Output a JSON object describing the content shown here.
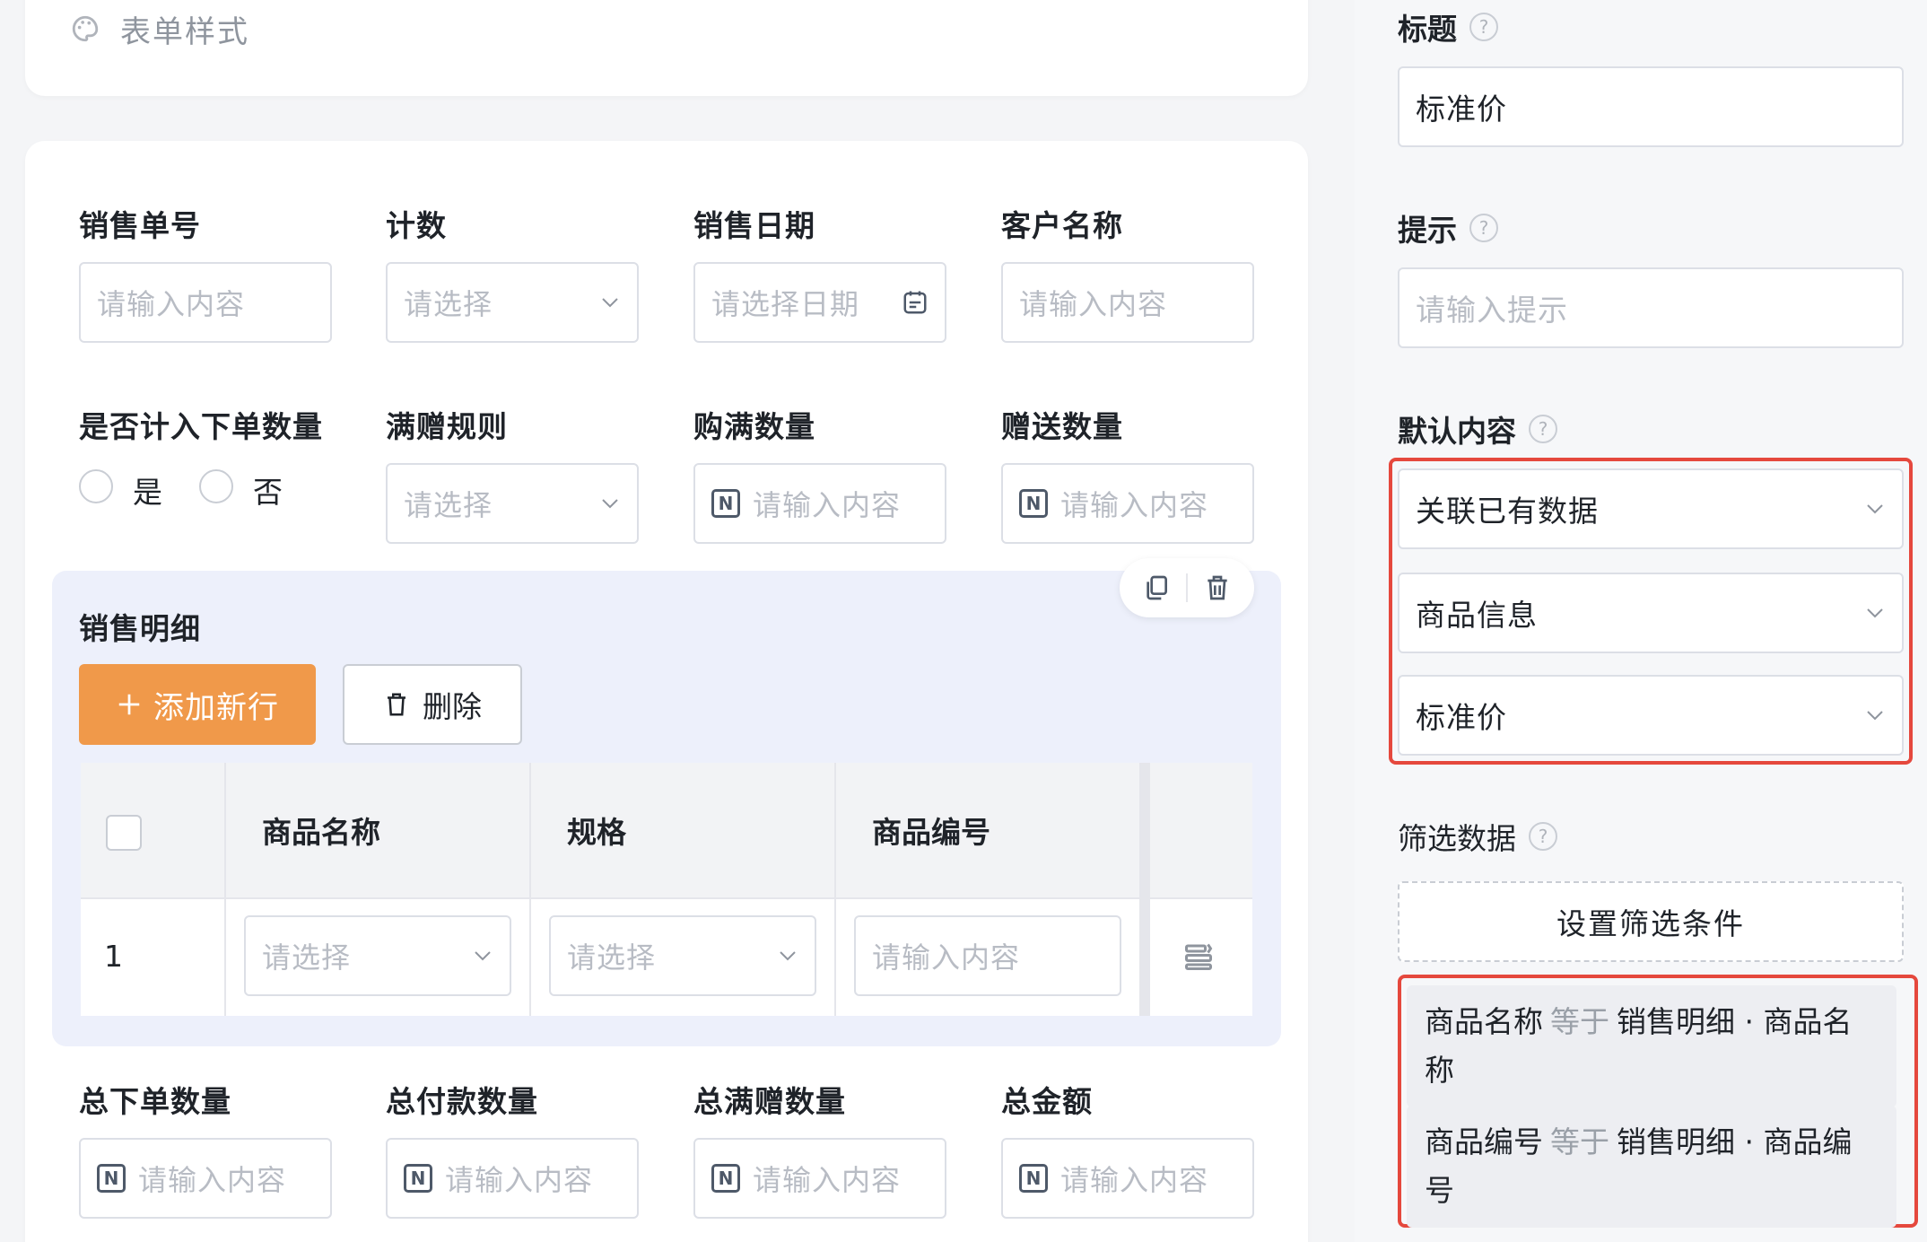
{
  "left": {
    "style_section": {
      "icon": "palette-icon",
      "label": "表单样式"
    },
    "row1": [
      {
        "label": "销售单号",
        "placeholder": "请输入内容",
        "kind": "text"
      },
      {
        "label": "计数",
        "placeholder": "请选择",
        "kind": "select"
      },
      {
        "label": "销售日期",
        "placeholder": "请选择日期",
        "kind": "date"
      },
      {
        "label": "客户名称",
        "placeholder": "请输入内容",
        "kind": "text"
      }
    ],
    "row2": {
      "radio_field": {
        "label": "是否计入下单数量",
        "options": [
          "是",
          "否"
        ]
      },
      "fields": [
        {
          "label": "满赠规则",
          "placeholder": "请选择",
          "kind": "select"
        },
        {
          "label": "购满数量",
          "placeholder": "请输入内容",
          "kind": "number"
        },
        {
          "label": "赠送数量",
          "placeholder": "请输入内容",
          "kind": "number"
        }
      ]
    },
    "subtable": {
      "title": "销售明细",
      "add_button": "添加新行",
      "delete_button": "删除",
      "columns": [
        "商品名称",
        "规格",
        "商品编号"
      ],
      "rows": [
        {
          "index": "1",
          "cells": [
            "请选择",
            "请选择",
            "请输入内容"
          ]
        }
      ]
    },
    "row3": [
      {
        "label": "总下单数量",
        "placeholder": "请输入内容"
      },
      {
        "label": "总付款数量",
        "placeholder": "请输入内容"
      },
      {
        "label": "总满赠数量",
        "placeholder": "请输入内容"
      },
      {
        "label": "总金额",
        "placeholder": "请输入内容"
      }
    ]
  },
  "panel": {
    "title_label": "标题",
    "title_value": "标准价",
    "hint_label": "提示",
    "hint_placeholder": "请输入提示",
    "default_label": "默认内容",
    "default_selects": [
      "关联已有数据",
      "商品信息",
      "标准价"
    ],
    "filter_label": "筛选数据",
    "filter_button": "设置筛选条件",
    "conditions": [
      {
        "field": "商品名称",
        "op": "等于",
        "value": "销售明细 · 商品名称"
      },
      {
        "field": "商品编号",
        "op": "等于",
        "value": "销售明细 · 商品编号"
      }
    ],
    "highlight_color": "#e5483d"
  }
}
